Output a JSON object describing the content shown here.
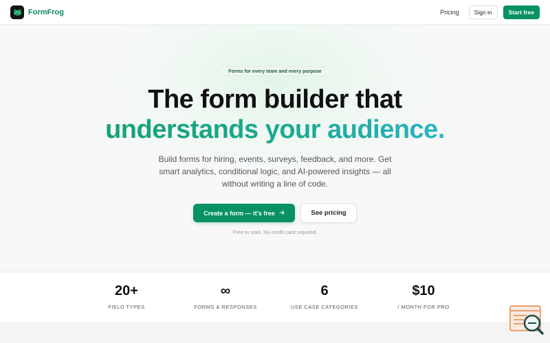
{
  "header": {
    "brand_name": "FormFrog",
    "logo_icon": "frog-icon",
    "nav_pricing": "Pricing",
    "sign_in": "Sign in",
    "start_free": "Start free"
  },
  "hero": {
    "badge": "Forms for every team and every purpose",
    "title_line1": "The form builder that",
    "title_line2": "understands your audience.",
    "subtitle": "Build forms for hiring, events, surveys, feedback, and more. Get smart analytics, conditional logic, and AI-powered insights — all without writing a line of code.",
    "primary_cta": "Create a form — it's free",
    "primary_cta_icon": "arrow-right-icon",
    "secondary_cta": "See pricing",
    "fineprint": "Free to start. No credit card required."
  },
  "stats": [
    {
      "value": "20+",
      "label": "FIELD TYPES"
    },
    {
      "value": "∞",
      "label": "FORMS & RESPONSES"
    },
    {
      "value": "6",
      "label": "USE CASE CATEGORIES"
    },
    {
      "value": "$10",
      "label": "/ MONTH FOR PRO"
    }
  ],
  "colors": {
    "brand_green": "#079165",
    "gradient_start": "#13a274",
    "gradient_end": "#2bb2c6",
    "dark": "#111111"
  },
  "helper_widget_icon": "search-help-icon"
}
